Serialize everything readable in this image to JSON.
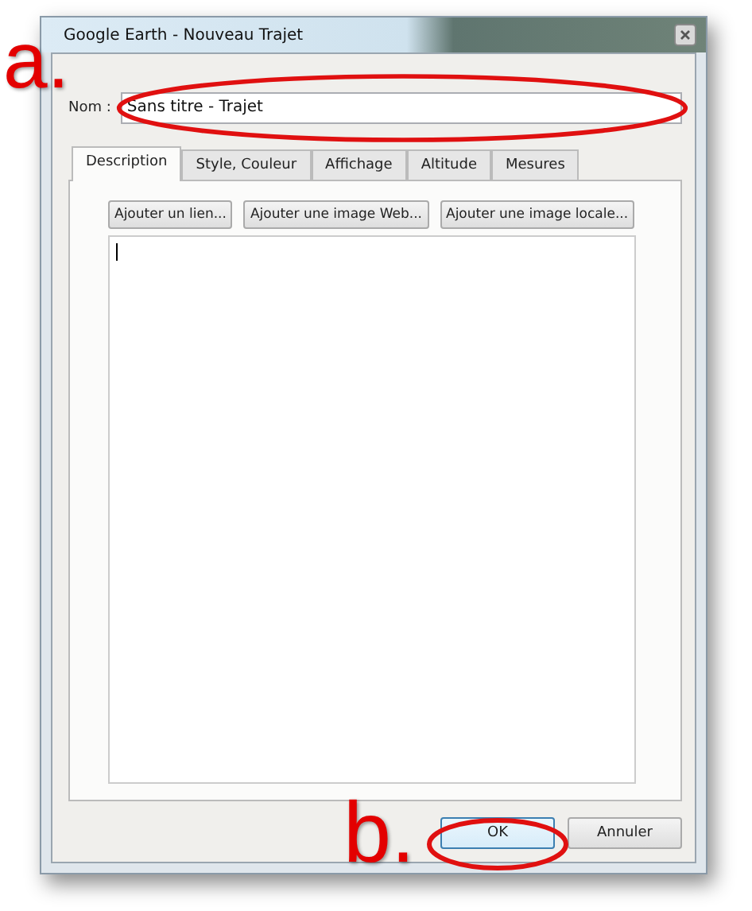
{
  "window": {
    "title": "Google Earth - Nouveau Trajet"
  },
  "name_field": {
    "label": "Nom :",
    "value": "Sans titre - Trajet"
  },
  "tabs": [
    {
      "label": "Description",
      "selected": true
    },
    {
      "label": "Style, Couleur",
      "selected": false
    },
    {
      "label": "Affichage",
      "selected": false
    },
    {
      "label": "Altitude",
      "selected": false
    },
    {
      "label": "Mesures",
      "selected": false
    }
  ],
  "insert_buttons": [
    "Ajouter un lien...",
    "Ajouter une image Web...",
    "Ajouter une image locale..."
  ],
  "dialog_buttons": [
    {
      "label": "OK",
      "default": true
    },
    {
      "label": "Annuler",
      "default": false
    }
  ],
  "annotations": [
    {
      "label": "a."
    },
    {
      "label": "b."
    }
  ]
}
